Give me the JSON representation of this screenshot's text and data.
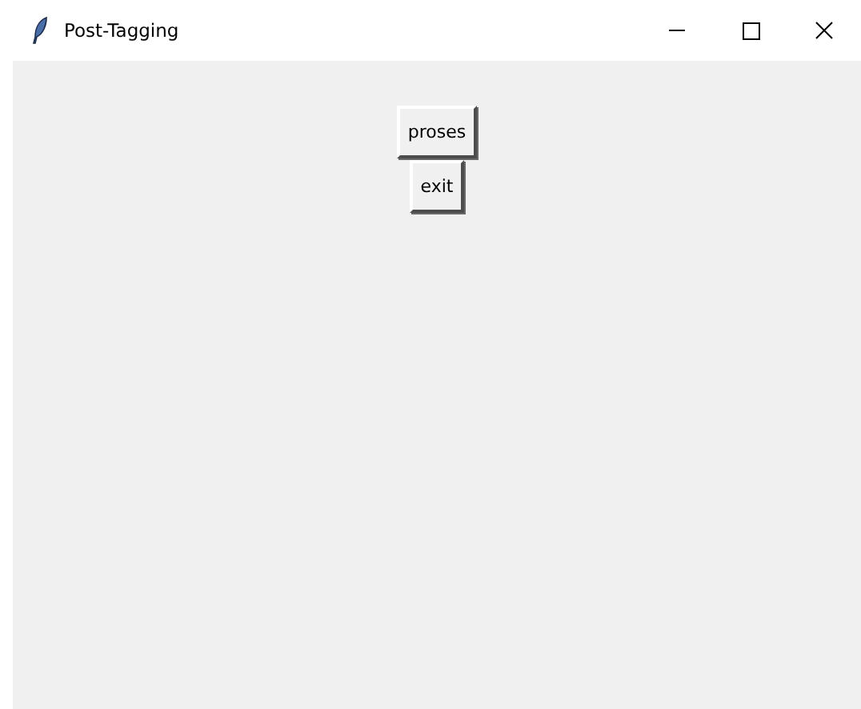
{
  "window": {
    "title": "Post-Tagging"
  },
  "buttons": [
    {
      "label": "proses"
    },
    {
      "label": "exit"
    }
  ]
}
